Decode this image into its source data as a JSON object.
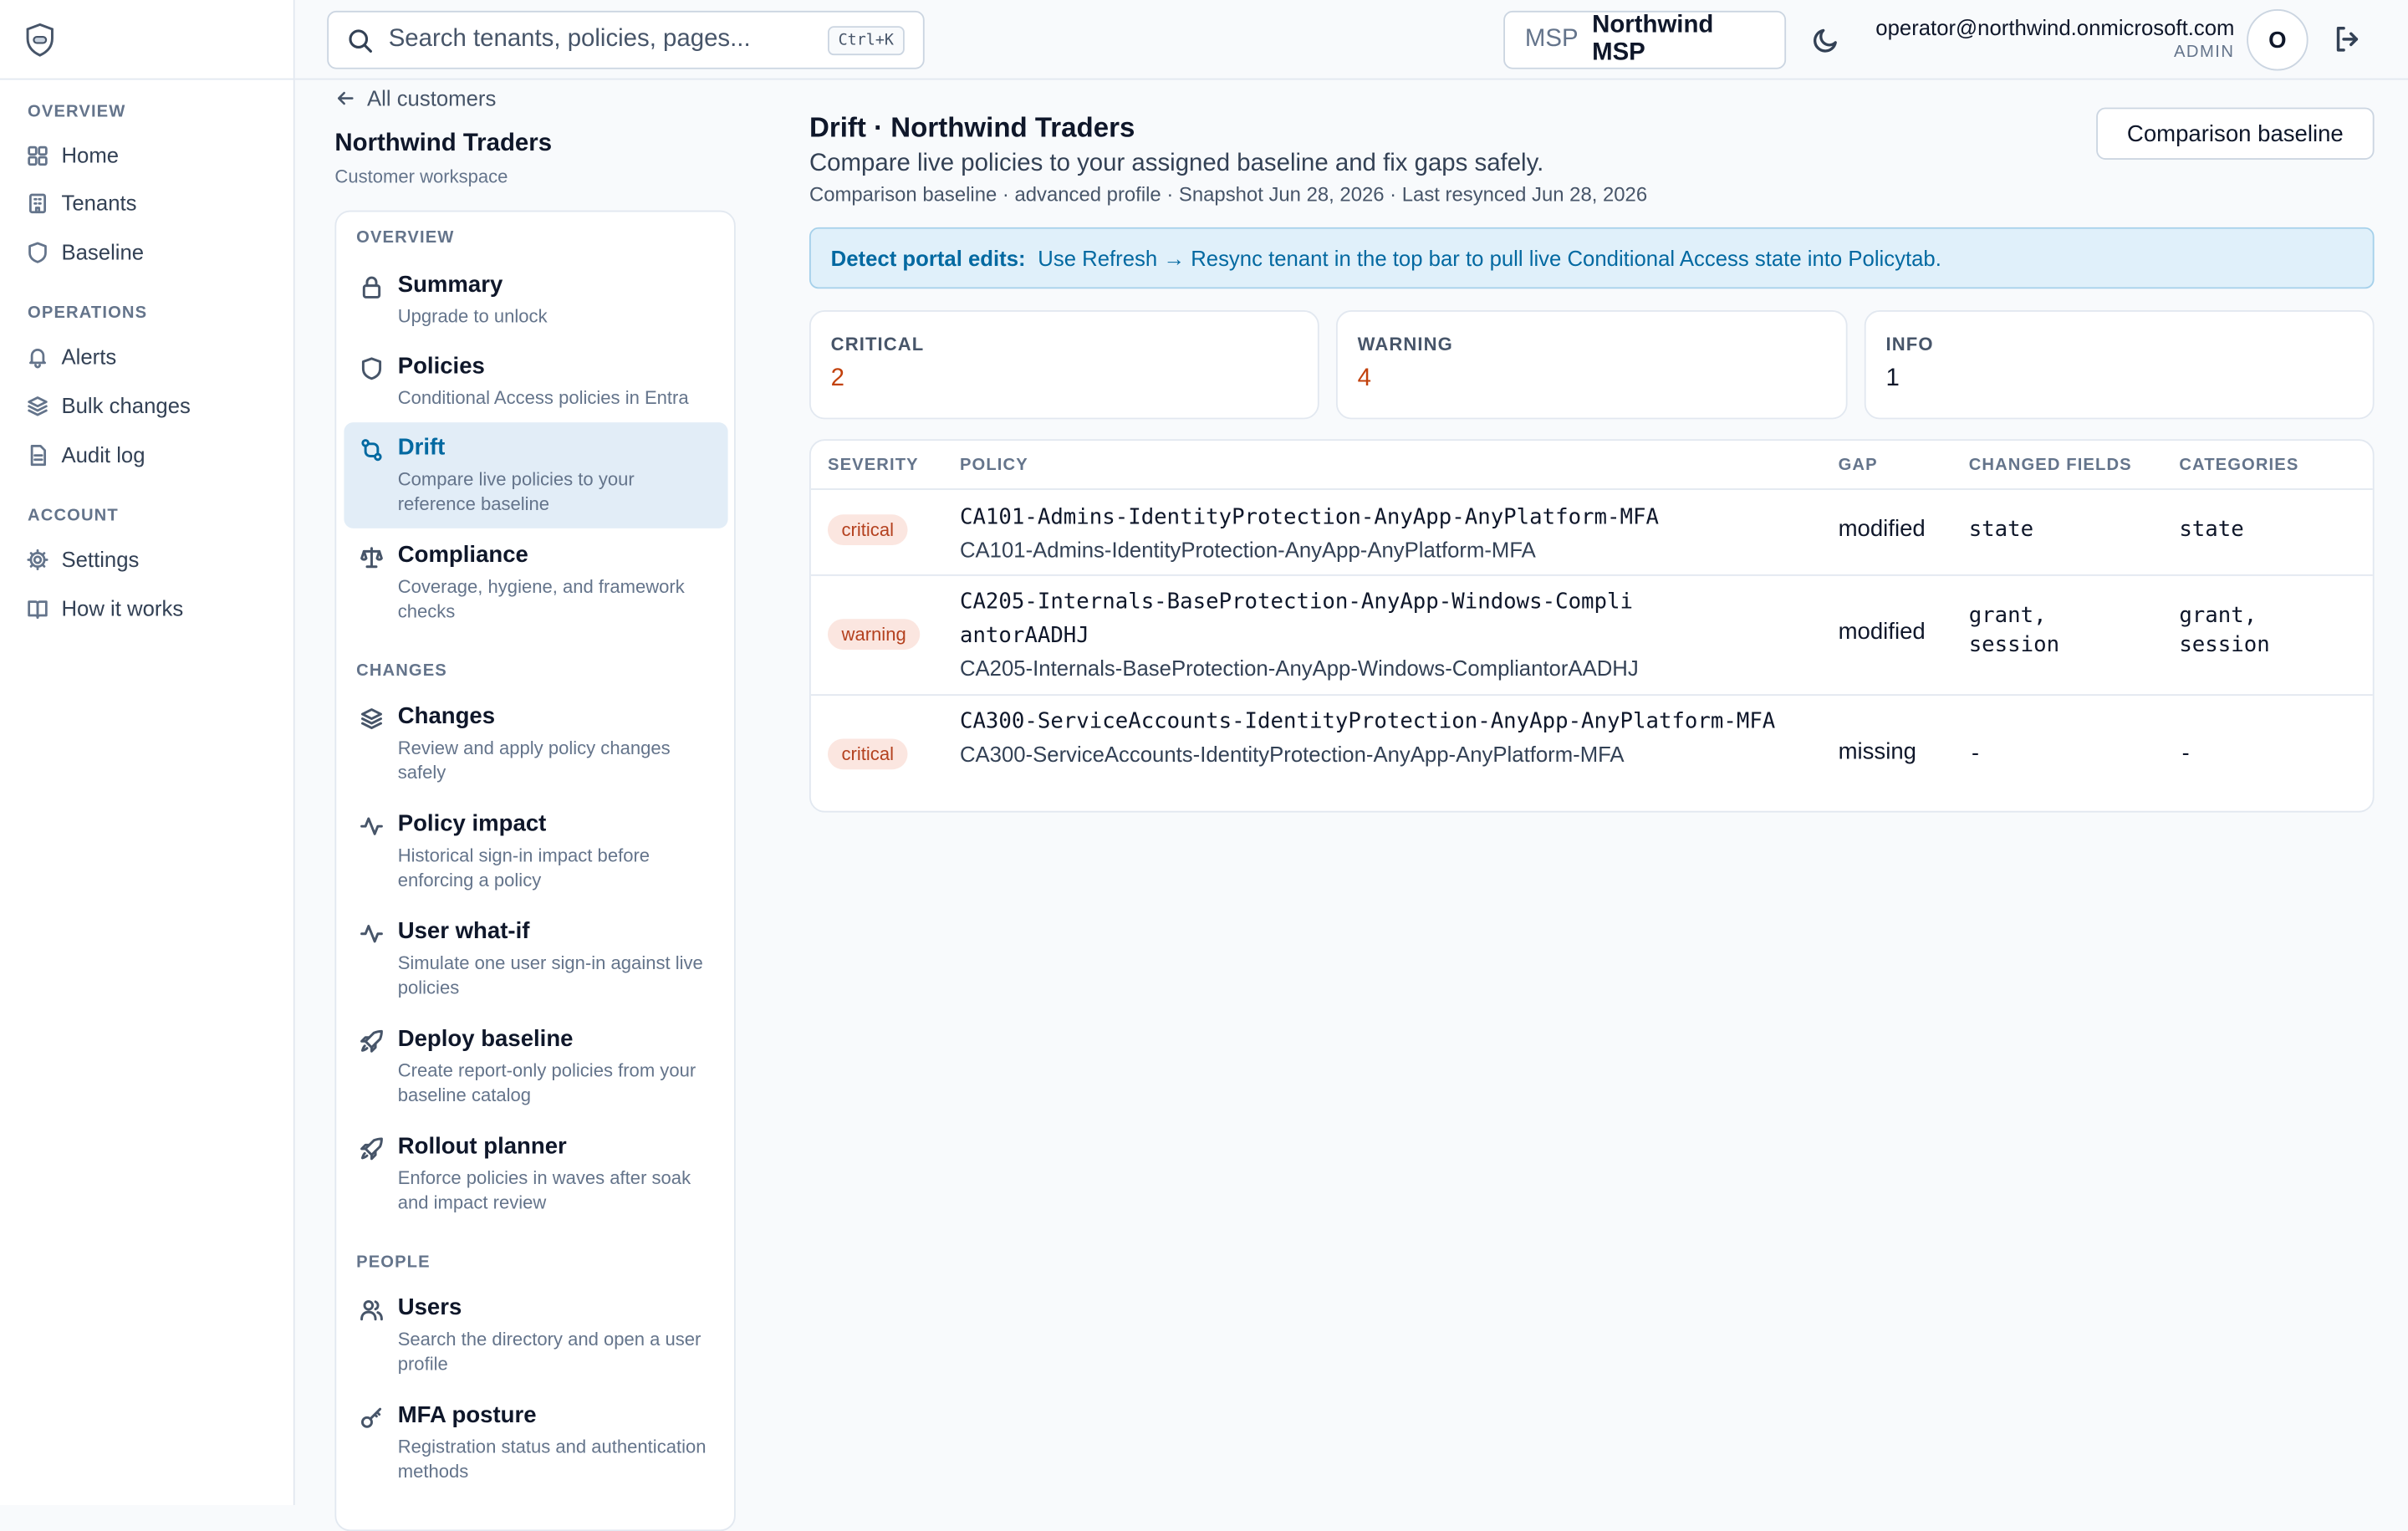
{
  "app_sidebar": {
    "sections": [
      {
        "label": "OVERVIEW",
        "items": [
          {
            "label": "Home",
            "icon": "grid-icon"
          },
          {
            "label": "Tenants",
            "icon": "building-icon"
          },
          {
            "label": "Baseline",
            "icon": "shield-icon"
          }
        ]
      },
      {
        "label": "OPERATIONS",
        "items": [
          {
            "label": "Alerts",
            "icon": "bell-icon"
          },
          {
            "label": "Bulk changes",
            "icon": "layers-icon"
          },
          {
            "label": "Audit log",
            "icon": "file-icon"
          }
        ]
      },
      {
        "label": "ACCOUNT",
        "items": [
          {
            "label": "Settings",
            "icon": "gear-icon"
          },
          {
            "label": "How it works",
            "icon": "book-icon"
          }
        ]
      }
    ]
  },
  "topbar": {
    "search_placeholder": "Search tenants, policies, pages...",
    "shortcut": "Ctrl+K",
    "msp_label": "MSP",
    "msp_name": "Northwind MSP",
    "user_email": "operator@northwind.onmicrosoft.com",
    "user_role": "ADMIN",
    "avatar_initial": "O"
  },
  "workspace": {
    "back_label": "All customers",
    "title": "Northwind Traders",
    "subtitle": "Customer workspace",
    "sections": [
      {
        "label": "OVERVIEW",
        "items": [
          {
            "title": "Summary",
            "desc": "Upgrade to unlock",
            "icon": "lock-icon"
          },
          {
            "title": "Policies",
            "desc": "Conditional Access policies in Entra",
            "icon": "shield-icon"
          },
          {
            "title": "Drift",
            "desc": "Compare live policies to your reference baseline",
            "icon": "git-compare-icon",
            "active": true
          },
          {
            "title": "Compliance",
            "desc": "Coverage, hygiene, and framework checks",
            "icon": "scale-icon"
          }
        ]
      },
      {
        "label": "CHANGES",
        "items": [
          {
            "title": "Changes",
            "desc": "Review and apply policy changes safely",
            "icon": "layers-icon"
          },
          {
            "title": "Policy impact",
            "desc": "Historical sign-in impact before enforcing a policy",
            "icon": "activity-icon"
          },
          {
            "title": "User what-if",
            "desc": "Simulate one user sign-in against live policies",
            "icon": "activity-icon"
          },
          {
            "title": "Deploy baseline",
            "desc": "Create report-only policies from your baseline catalog",
            "icon": "rocket-icon"
          },
          {
            "title": "Rollout planner",
            "desc": "Enforce policies in waves after soak and impact review",
            "icon": "rocket-icon"
          }
        ]
      },
      {
        "label": "PEOPLE",
        "items": [
          {
            "title": "Users",
            "desc": "Search the directory and open a user profile",
            "icon": "users-icon"
          },
          {
            "title": "MFA posture",
            "desc": "Registration status and authentication methods",
            "icon": "key-icon"
          }
        ]
      }
    ]
  },
  "main": {
    "title": "Drift · Northwind Traders",
    "subtitle": "Compare live policies to your assigned baseline and fix gaps safely.",
    "meta": "Comparison baseline · advanced profile · Snapshot Jun 28, 2026 · Last resynced Jun 28, 2026",
    "baseline_button": "Comparison baseline",
    "banner_strong": "Detect portal edits:",
    "banner_text": "Use Refresh → Resync tenant in the top bar to pull live Conditional Access state into Policytab.",
    "stats": [
      {
        "label": "CRITICAL",
        "value": "2",
        "color": "#c2410c"
      },
      {
        "label": "WARNING",
        "value": "4",
        "color": "#c2410c"
      },
      {
        "label": "INFO",
        "value": "1",
        "color": "#0f172a"
      }
    ],
    "table": {
      "headers": [
        "SEVERITY",
        "POLICY",
        "GAP",
        "CHANGED FIELDS",
        "CATEGORIES"
      ],
      "rows": [
        {
          "severity": "critical",
          "policy_mono": "CA101-Admins-IdentityProtection-AnyApp-AnyPlatform-MFA",
          "policy_name": "CA101-Admins-IdentityProtection-AnyApp-AnyPlatform-MFA",
          "gap": "modified",
          "changed_fields": "state",
          "categories": "state"
        },
        {
          "severity": "warning",
          "policy_mono": "CA205-Internals-BaseProtection-AnyApp-Windows-CompliantorAADHJ",
          "policy_name": "CA205-Internals-BaseProtection-AnyApp-Windows-CompliantorAADHJ",
          "gap": "modified",
          "changed_fields": "grant, session",
          "categories": "grant, session"
        },
        {
          "severity": "critical",
          "policy_mono": "CA300-ServiceAccounts-IdentityProtection-AnyApp-AnyPlatform-MFA",
          "policy_name": "CA300-ServiceAccounts-IdentityProtection-AnyApp-AnyPlatform-MFA",
          "gap": "missing",
          "changed_fields": "-",
          "categories": "-"
        }
      ]
    }
  }
}
